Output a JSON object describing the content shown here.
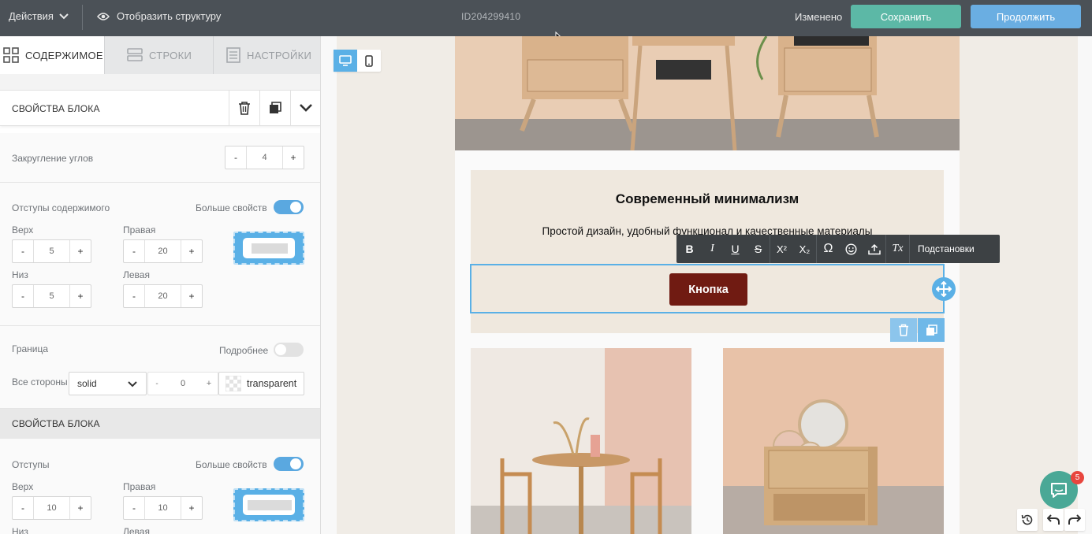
{
  "topbar": {
    "actions_label": "Действия",
    "structure_label": "Отобразить структуру",
    "document_id": "ID204299410",
    "status": "Изменено",
    "save_label": "Сохранить",
    "continue_label": "Продолжить"
  },
  "tabs": [
    {
      "label": "СОДЕРЖИМОЕ",
      "icon": "grid-icon",
      "active": true
    },
    {
      "label": "СТРОКИ",
      "icon": "rows-icon",
      "active": false
    },
    {
      "label": "НАСТРОЙКИ",
      "icon": "settings-doc-icon",
      "active": false
    }
  ],
  "block_props": {
    "title": "СВОЙСТВА БЛОКА",
    "corner_radius": {
      "label": "Закругление углов",
      "value": "4"
    },
    "content_padding": {
      "label": "Отступы содержимого",
      "more_label": "Больше свойств",
      "more_enabled": true,
      "top": {
        "label": "Верх",
        "value": "5"
      },
      "right": {
        "label": "Правая",
        "value": "20"
      },
      "bottom": {
        "label": "Низ",
        "value": "5"
      },
      "left": {
        "label": "Левая",
        "value": "20"
      }
    },
    "border": {
      "label": "Граница",
      "details_label": "Подробнее",
      "details_enabled": false,
      "all_sides_label": "Все стороны",
      "style": "solid",
      "width": "0",
      "color": "transparent"
    }
  },
  "block_props_2": {
    "title": "СВОЙСТВА БЛОКА",
    "padding": {
      "label": "Отступы",
      "more_label": "Больше свойств",
      "more_enabled": true,
      "top": {
        "label": "Верх",
        "value": "10"
      },
      "right": {
        "label": "Правая",
        "value": "10"
      },
      "bottom_label": "Низ",
      "left_label": "Левая"
    }
  },
  "stepper": {
    "minus": "-",
    "plus": "+"
  },
  "editor": {
    "heading": "Современный минимализм",
    "subtitle": "Простой дизайн, удобный функционал и качественные материалы",
    "button_label": "Кнопка",
    "toolbar": {
      "buttons": [
        "bold-icon",
        "italic-icon",
        "underline-icon",
        "strikethrough-icon",
        "superscript-icon",
        "subscript-icon",
        "omega-icon",
        "emoji-icon",
        "upload-icon",
        "clear-format-icon"
      ],
      "bold": "B",
      "italic": "I",
      "underline": "U",
      "strike": "S",
      "sup": "X²",
      "sub": "X₂",
      "omega": "Ω",
      "clear": "Tx",
      "merge_tags_label": "Подстановки"
    }
  },
  "chat": {
    "badge": "5"
  },
  "colors": {
    "topbar": "#4b5157",
    "save": "#5cb8a6",
    "continue": "#6aaee2",
    "accent": "#5ab0e6",
    "cta_button": "#701b12",
    "banner_bg": "#efe8de"
  }
}
